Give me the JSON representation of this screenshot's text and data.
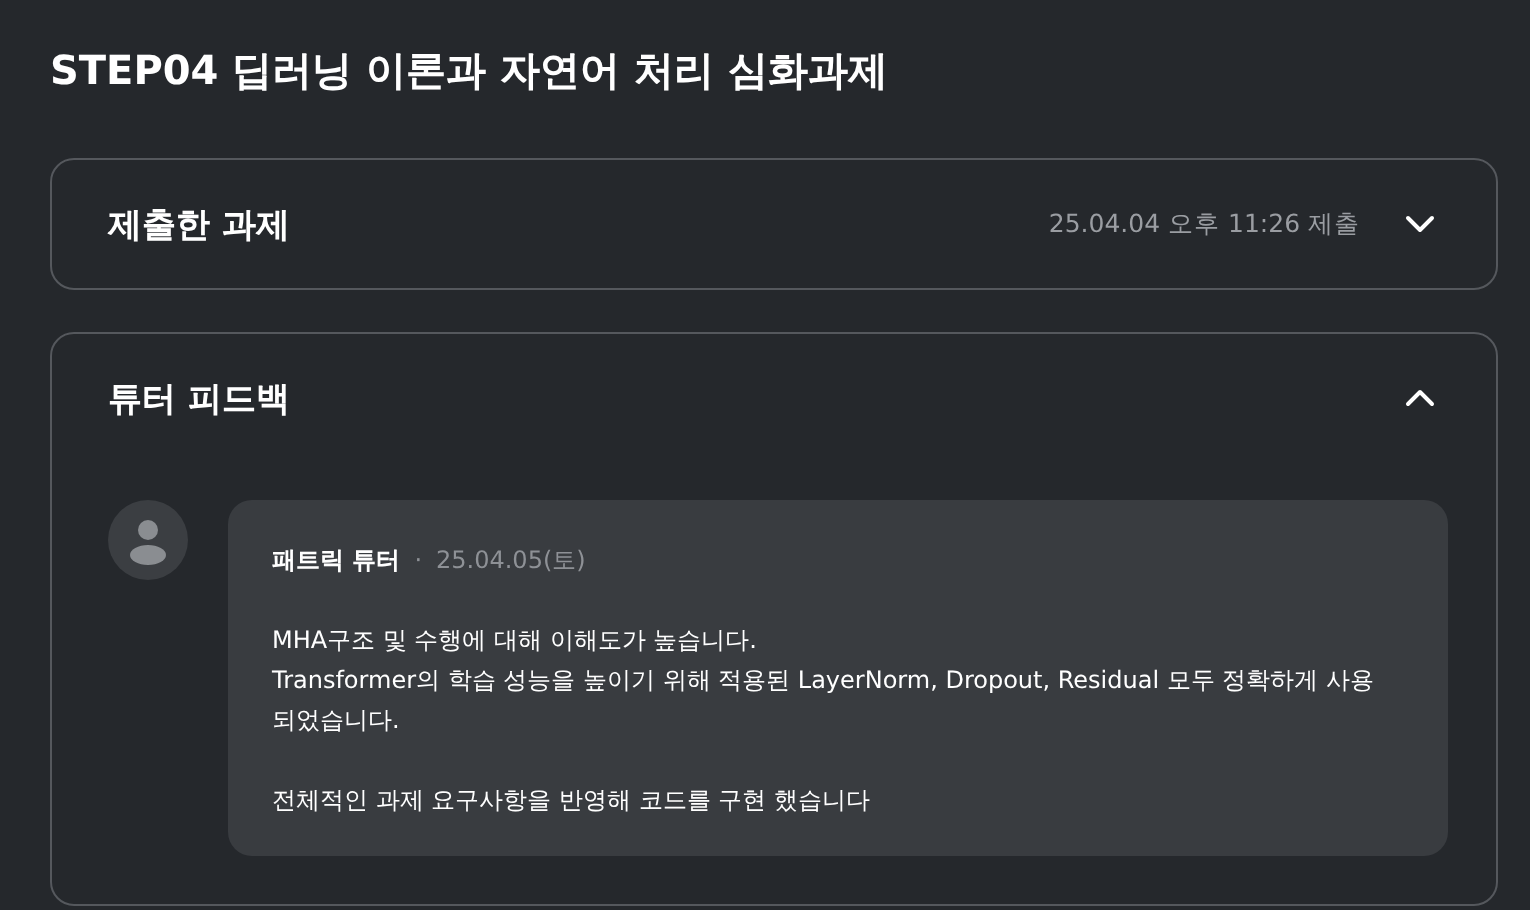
{
  "page_title": "STEP04 딥러닝 이론과 자연어 처리 심화과제",
  "sections": [
    {
      "title": "제출한 과제",
      "meta": "25.04.04 오후 11:26 제출",
      "expanded": false
    },
    {
      "title": "튜터 피드백",
      "expanded": true,
      "feedback": {
        "author": "패트릭 튜터",
        "separator": "·",
        "date": "25.04.05(토)",
        "paragraphs": [
          [
            "MHA구조 및 수행에 대해 이해도가 높습니다.",
            "Transformer의 학습 성능을 높이기 위해 적용된 LayerNorm, Dropout, Residual 모두 정확하게 사용 되었습니다."
          ],
          [
            "전체적인 과제 요구사항을 반영해 코드를 구현 했습니다"
          ]
        ]
      }
    }
  ]
}
